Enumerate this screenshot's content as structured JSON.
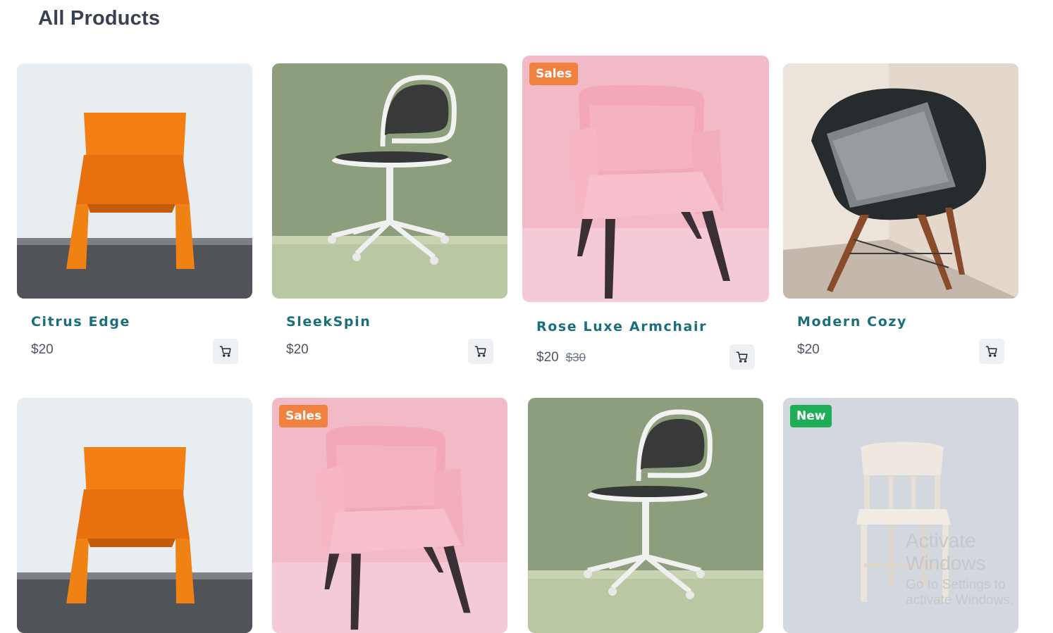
{
  "page": {
    "title": "All Products"
  },
  "products": [
    {
      "name": "Citrus Edge",
      "price": "$20",
      "old_price": "",
      "badge": "",
      "image": "orange-chair"
    },
    {
      "name": "SleekSpin",
      "price": "$20",
      "old_price": "",
      "badge": "",
      "image": "office-swivel-chair"
    },
    {
      "name": "Rose Luxe Armchair",
      "price": "$20",
      "old_price": "$30",
      "badge": "Sales",
      "image": "pink-armchair"
    },
    {
      "name": "Modern Cozy",
      "price": "$20",
      "old_price": "",
      "badge": "",
      "image": "black-shell-chair"
    },
    {
      "name": "",
      "price": "",
      "old_price": "",
      "badge": "",
      "image": "orange-chair"
    },
    {
      "name": "",
      "price": "",
      "old_price": "",
      "badge": "Sales",
      "image": "pink-armchair"
    },
    {
      "name": "",
      "price": "",
      "old_price": "",
      "badge": "",
      "image": "office-swivel-chair"
    },
    {
      "name": "",
      "price": "",
      "old_price": "",
      "badge": "New",
      "image": "white-wooden-chair"
    }
  ],
  "icons": {
    "cart": "shopping-cart-icon"
  },
  "colors": {
    "product_name": "#1a6f79",
    "sales_badge": "#f0813f",
    "new_badge": "#1fae57"
  },
  "watermark": {
    "line1": "Activate Windows",
    "line2": "Go to Settings to activate Windows."
  }
}
